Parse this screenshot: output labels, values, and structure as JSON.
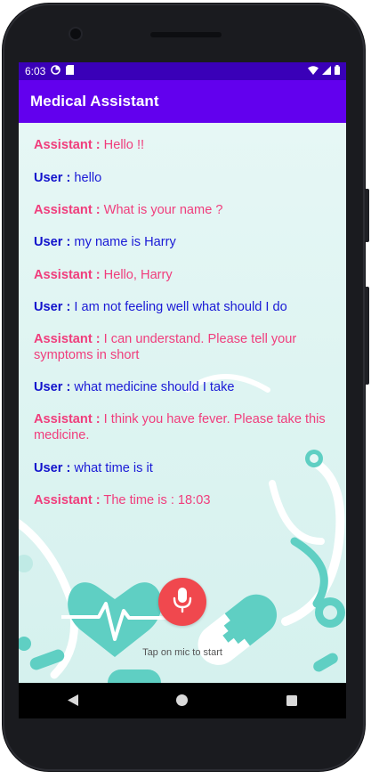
{
  "status_bar": {
    "time": "6:03",
    "icons": [
      "data-saver-icon",
      "sim-icon",
      "wifi-icon",
      "signal-icon",
      "battery-icon"
    ]
  },
  "app_bar": {
    "title": "Medical Assistant"
  },
  "messages": [
    {
      "speaker": "Assistant :",
      "text": " Hello !!",
      "role": "assistant"
    },
    {
      "speaker": "User :",
      "text": " hello",
      "role": "user"
    },
    {
      "speaker": "Assistant :",
      "text": " What is your name ?",
      "role": "assistant"
    },
    {
      "speaker": "User :",
      "text": " my name is Harry",
      "role": "user"
    },
    {
      "speaker": "Assistant :",
      "text": " Hello, Harry",
      "role": "assistant"
    },
    {
      "speaker": "User :",
      "text": " I am not feeling well what should I do",
      "role": "user"
    },
    {
      "speaker": "Assistant :",
      "text": " I can understand. Please tell your symptoms in short",
      "role": "assistant"
    },
    {
      "speaker": "User :",
      "text": " what medicine should I take",
      "role": "user"
    },
    {
      "speaker": "Assistant :",
      "text": " I think you have fever. Please take this medicine.",
      "role": "assistant"
    },
    {
      "speaker": "User :",
      "text": " what time is it",
      "role": "user"
    },
    {
      "speaker": "Assistant :",
      "text": " The time is : 18:03",
      "role": "assistant"
    }
  ],
  "mic": {
    "hint": "Tap on mic to start",
    "icon": "microphone-icon"
  },
  "nav": {
    "back": "back-icon",
    "home": "home-icon",
    "recents": "recents-icon"
  },
  "colors": {
    "app_bar": "#6200ee",
    "status_bar": "#3a00b8",
    "assistant_text": "#f03d7c",
    "user_text": "#1a1ad6",
    "mic_button": "#f0484e",
    "art_teal": "#5fcfc3"
  }
}
